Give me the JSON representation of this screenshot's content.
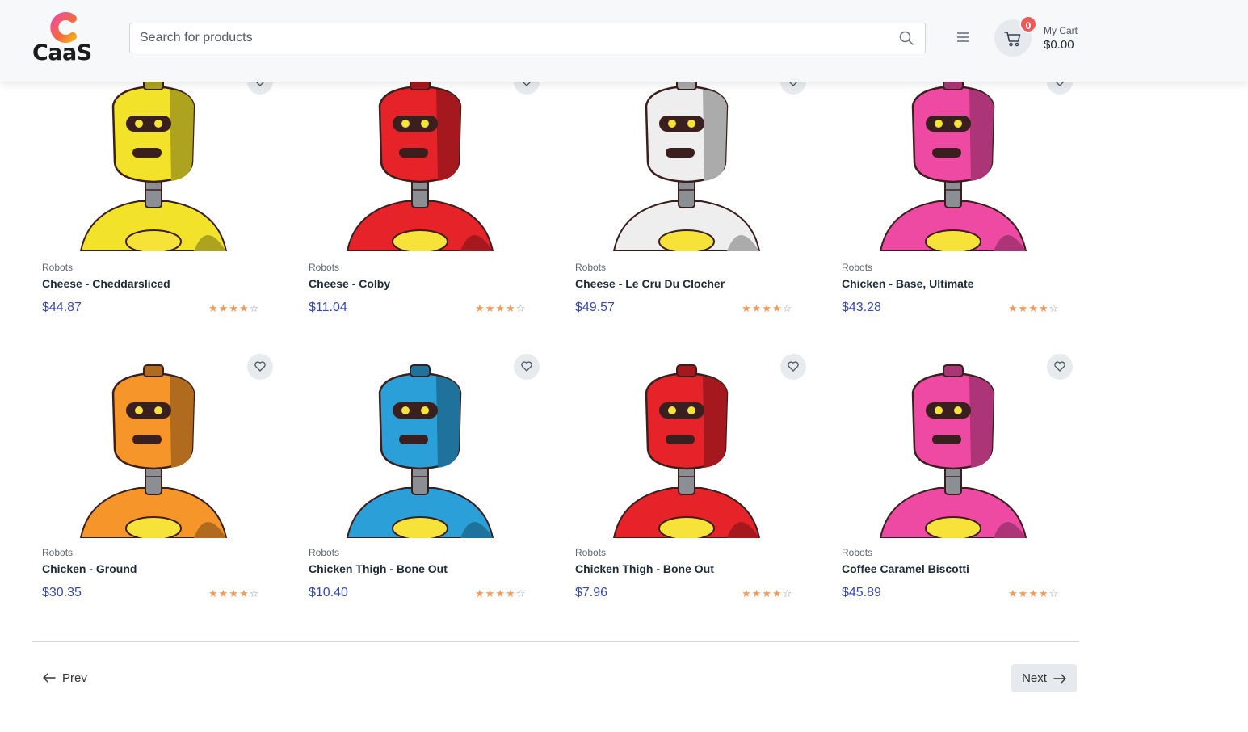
{
  "header": {
    "logo_letter": "C",
    "logo_text": "CaaS",
    "search_placeholder": "Search for products",
    "cart_count": "0",
    "cart_label": "My Cart",
    "cart_total": "$0.00"
  },
  "products": [
    {
      "category": "Robots",
      "name": "Cheese - Cheddarsliced",
      "price": "$44.87",
      "rating": 4,
      "robot_color": "#f2e22a"
    },
    {
      "category": "Robots",
      "name": "Cheese - Colby",
      "price": "$11.04",
      "rating": 4,
      "robot_color": "#e52329"
    },
    {
      "category": "Robots",
      "name": "Cheese - Le Cru Du Clocher",
      "price": "$49.57",
      "rating": 4,
      "robot_color": "#eeeeee"
    },
    {
      "category": "Robots",
      "name": "Chicken - Base, Ultimate",
      "price": "$43.28",
      "rating": 4,
      "robot_color": "#ee4aa4"
    },
    {
      "category": "Robots",
      "name": "Chicken - Ground",
      "price": "$30.35",
      "rating": 4,
      "robot_color": "#f5952a"
    },
    {
      "category": "Robots",
      "name": "Chicken Thigh - Bone Out",
      "price": "$10.40",
      "rating": 4,
      "robot_color": "#2a9fd8"
    },
    {
      "category": "Robots",
      "name": "Chicken Thigh - Bone Out",
      "price": "$7.96",
      "rating": 4,
      "robot_color": "#e52329"
    },
    {
      "category": "Robots",
      "name": "Coffee Caramel Biscotti",
      "price": "$45.89",
      "rating": 4,
      "robot_color": "#ee4aa4"
    }
  ],
  "pagination": {
    "prev_label": "Prev",
    "next_label": "Next"
  },
  "colors": {
    "price": "#3748ad",
    "star": "#f09b5c",
    "badge": "#ee5a5a"
  }
}
